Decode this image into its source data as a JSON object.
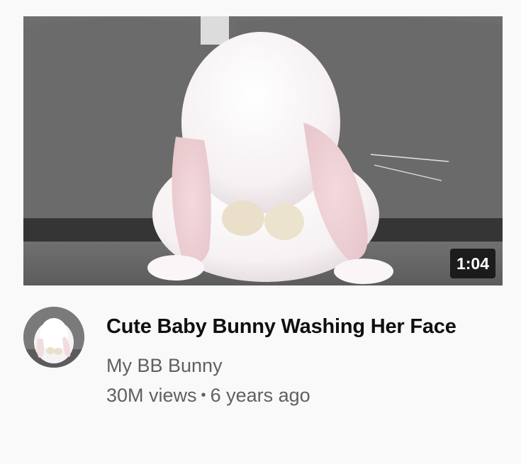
{
  "video": {
    "thumbnail_icon": "bunny-thumbnail",
    "duration": "1:04",
    "title": "Cute Baby Bunny Washing Her Face",
    "channel_name": "My BB Bunny",
    "views": "30M views",
    "separator": "•",
    "age": "6 years ago"
  },
  "colors": {
    "background": "#f9f9f9",
    "title": "#0f0f0f",
    "secondary_text": "#606060",
    "duration_badge": "#141414"
  }
}
